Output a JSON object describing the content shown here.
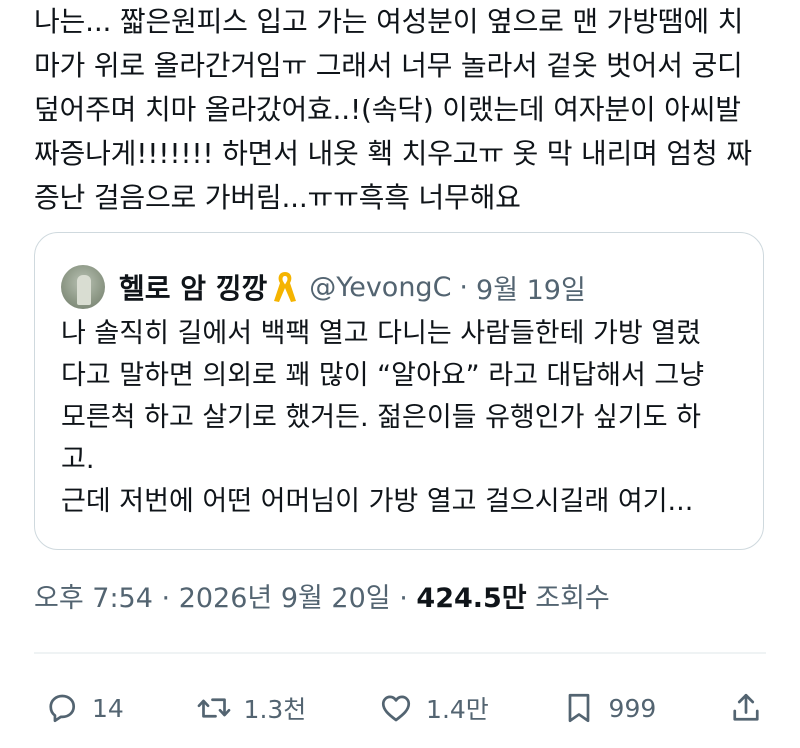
{
  "tweet": {
    "lines": [
      "나는... 짧은원피스 입고 가는 여성분이 옆으로 맨 가방땜에 치",
      "마가 위로 올라간거임ㅠ 그래서 너무 놀라서 겉옷 벗어서 궁디",
      "덮어주며 치마 올라갔어효..!(속닥) 이랬는데 여자분이 아씨발",
      "짜증나게!!!!!!! 하면서 내옷 홱 치우고ㅠ 옷 막 내리며 엄청 짜",
      "증난 걸음으로 가버림...ㅠㅠ흑흑 너무해요"
    ]
  },
  "quote": {
    "name": "헬로 암 낑깡",
    "handle": "@YevongC",
    "separator": "·",
    "date": "9월 19일",
    "lines": [
      "나 솔직히 길에서 백팩 열고 다니는 사람들한테 가방 열렸",
      "다고 말하면 의외로 꽤 많이 “알아요” 라고 대답해서 그냥",
      "모른척 하고 살기로 했거든. 젊은이들 유행인가 싶기도 하",
      "고.",
      "근데 저번에 어떤 어머님이 가방 열고 걸으시길래 여기..."
    ],
    "ribbon_icon": "yellow-ribbon-icon",
    "ribbon_color": "#f5b400"
  },
  "meta": {
    "time": "오후 7:54",
    "sep1": "·",
    "date": "2026년 9월 20일",
    "sep2": "·",
    "views_count": "424.5만",
    "views_label": "조회수"
  },
  "actions": {
    "reply": {
      "icon": "reply-icon",
      "count": "14"
    },
    "retweet": {
      "icon": "retweet-icon",
      "count": "1.3천"
    },
    "like": {
      "icon": "heart-icon",
      "count": "1.4만"
    },
    "bookmark": {
      "icon": "bookmark-icon",
      "count": "999"
    },
    "share": {
      "icon": "share-icon"
    }
  },
  "colors": {
    "text": "#0f1419",
    "secondary": "#536471",
    "border": "#cfd9de"
  }
}
